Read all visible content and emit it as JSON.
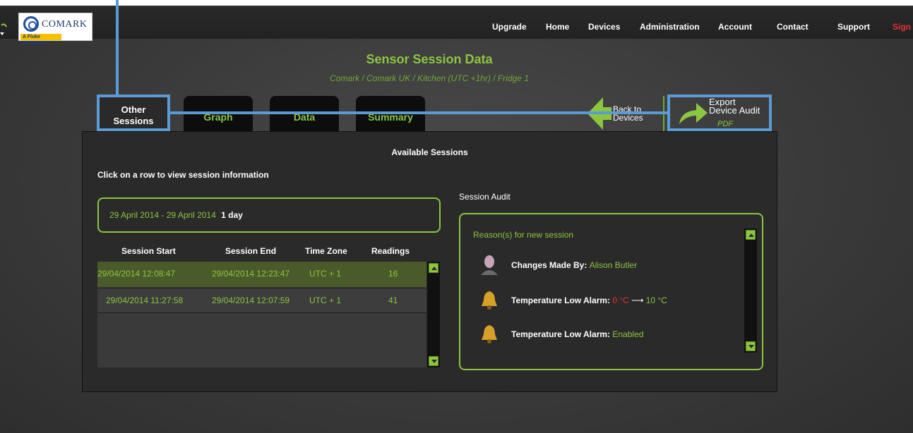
{
  "brand": {
    "name": "COMARK",
    "tagline": "A Fluke Company"
  },
  "nav": {
    "items": [
      "Upgrade",
      "Home",
      "Devices",
      "Administration",
      "Account",
      "Contact",
      "Support"
    ],
    "signin_partial": "Sign"
  },
  "header": {
    "title": "Sensor Session Data",
    "breadcrumb": "Comark  / Comark UK  / Kitchen  (UTC +1hr) / Fridge 1"
  },
  "tabs": {
    "other_sessions_line1": "Other",
    "other_sessions_line2": "Sessions",
    "graph": "Graph",
    "data": "Data",
    "summary": "Summary"
  },
  "actions": {
    "back_line1": "Back to",
    "back_line2": "Devices",
    "export_line1": "Export",
    "export_line2": "Device Audit",
    "export_format": "PDF"
  },
  "colors": {
    "accent": "#8cc63f",
    "annotation": "#5b9bd5",
    "alert": "#e23232"
  },
  "panel": {
    "heading": "Available Sessions",
    "hint": "Click on a row to view session information",
    "date_range": "29 April 2014 - 29 April 2014",
    "duration": "1 day"
  },
  "table": {
    "headers": [
      "Session Start",
      "Session End",
      "Time Zone",
      "Readings"
    ],
    "rows": [
      {
        "start": "29/04/2014 12:08:47",
        "end": "29/04/2014 12:23:47",
        "tz": "UTC + 1",
        "readings": "16"
      },
      {
        "start": "29/04/2014 11:27:58",
        "end": "29/04/2014 12:07:59",
        "tz": "UTC + 1",
        "readings": "41"
      }
    ]
  },
  "audit": {
    "title": "Session Audit",
    "reason_heading": "Reason(s) for new session",
    "changes_label": "Changes Made By:",
    "changes_user": "Alison Butler",
    "alarm1_label": "Temperature Low Alarm:",
    "alarm1_from": "0 °C",
    "arrow": "⟶",
    "alarm1_to": "10 °C",
    "alarm2_label": "Temperature Low Alarm:",
    "alarm2_value": "Enabled"
  }
}
